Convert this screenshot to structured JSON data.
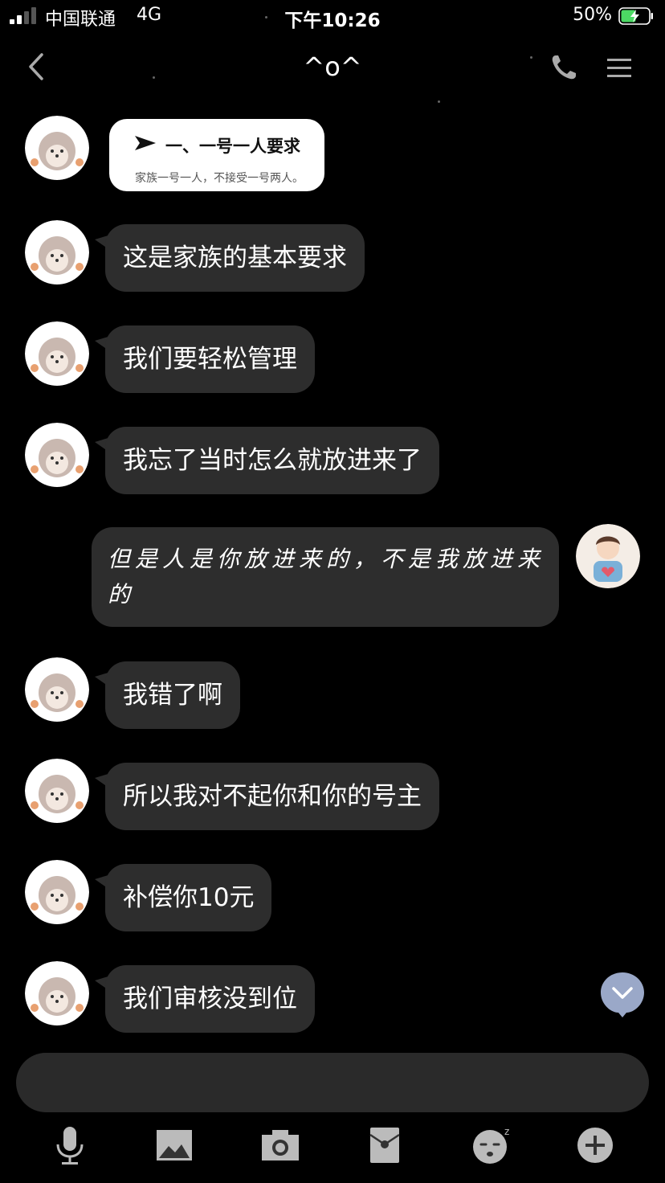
{
  "status_bar": {
    "carrier": "中国联通",
    "network": "4G",
    "time": "下午10:26",
    "battery": "50%"
  },
  "header": {
    "title": "^o^"
  },
  "messages": [
    {
      "type": "card",
      "title": "一、一号一人要求",
      "subtitle": "家族一号一人，不接受一号两人。"
    },
    {
      "text": "这是家族的基本要求"
    },
    {
      "text": "我们要轻松管理"
    },
    {
      "text": "我忘了当时怎么就放进来了"
    },
    {
      "text": "但是人是你放进来的，不是我放进来的",
      "outgoing": true
    },
    {
      "text": "我错了啊"
    },
    {
      "text": "所以我对不起你和你的号主"
    },
    {
      "text": "补偿你10元"
    },
    {
      "text": "我们审核没到位"
    }
  ]
}
